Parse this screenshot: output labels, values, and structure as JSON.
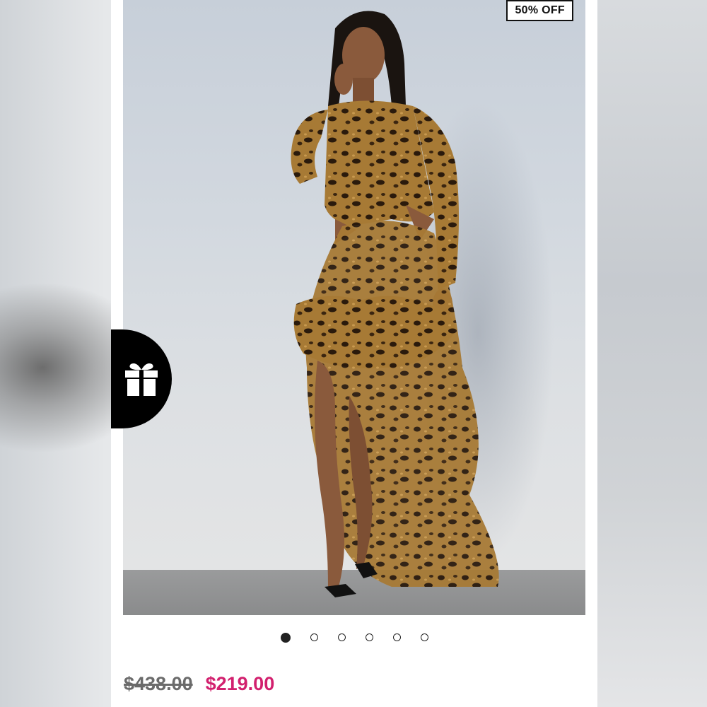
{
  "product": {
    "discount_badge": "50% OFF",
    "image_alt": "Model wearing leopard print ruffled high-low maxi dress",
    "price_original": "$438.00",
    "price_sale": "$219.00"
  },
  "carousel": {
    "count": 6,
    "active_index": 0
  },
  "gift_button": {
    "icon": "gift-icon"
  },
  "colors": {
    "sale_price": "#d2206e",
    "badge_border": "#111111",
    "gift_button_bg": "#000000"
  }
}
